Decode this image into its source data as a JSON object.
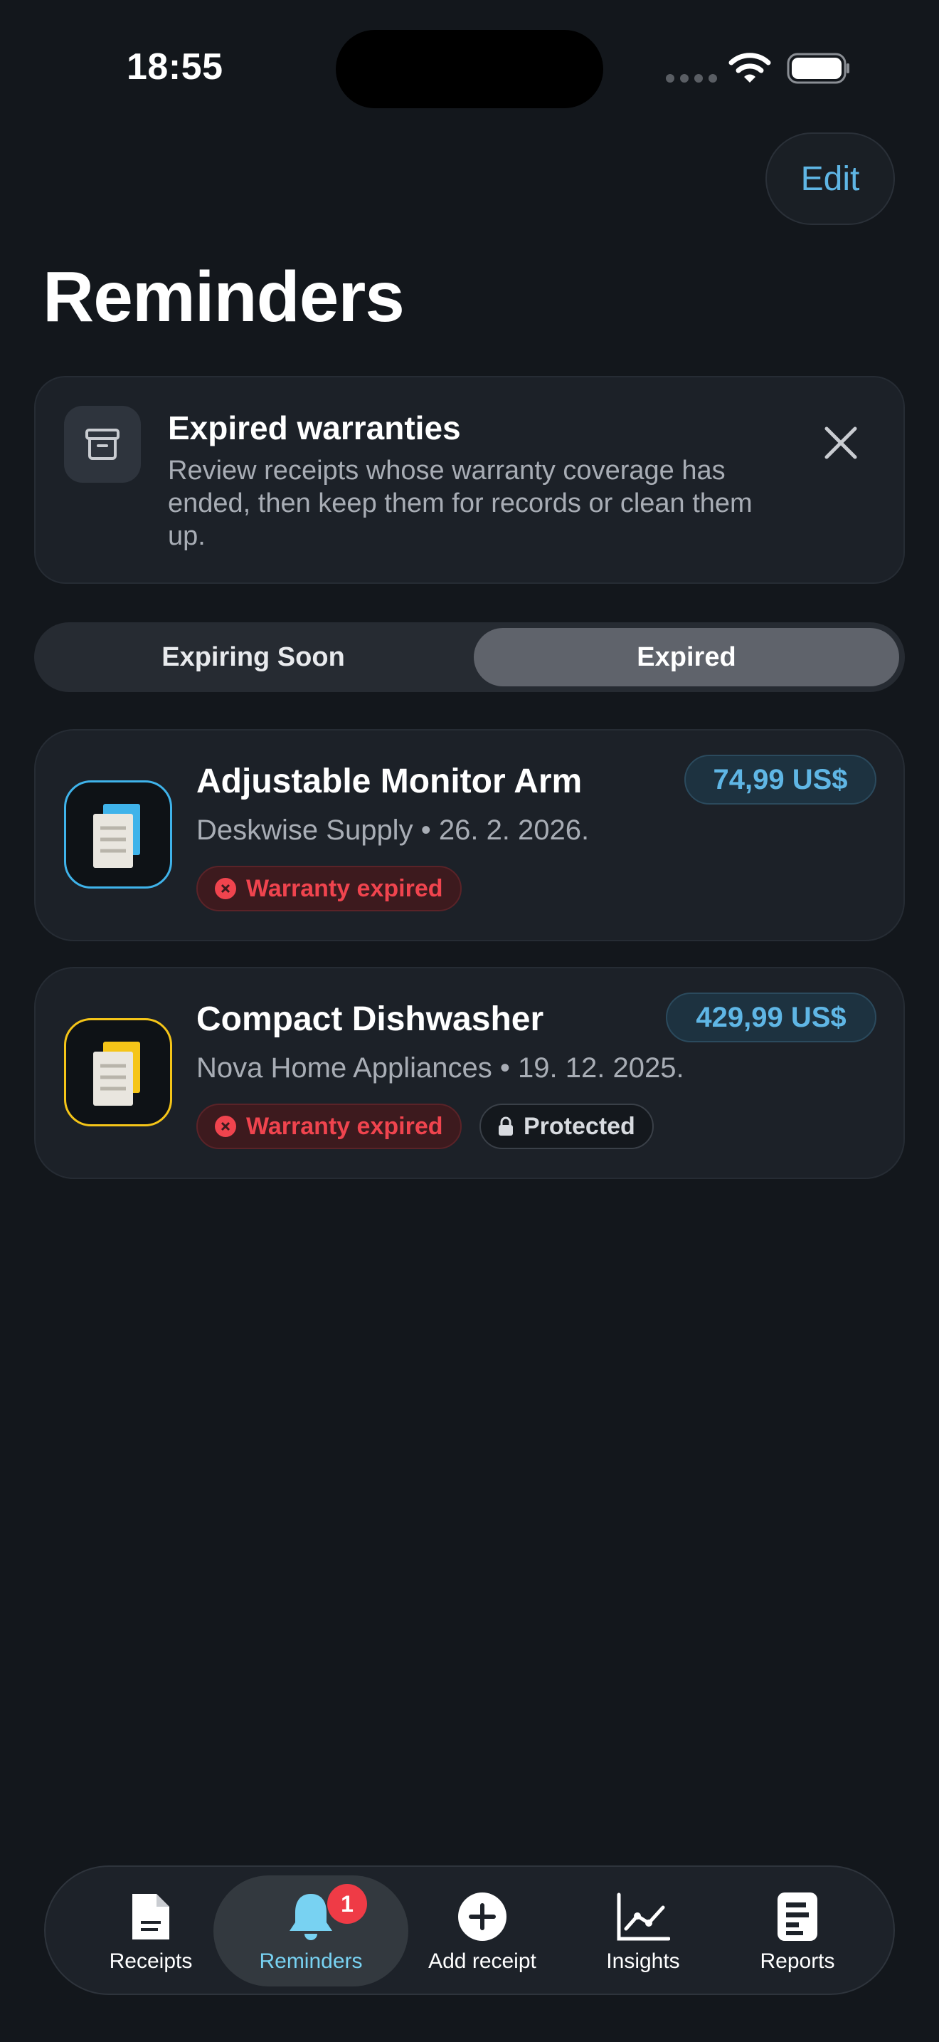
{
  "status_bar": {
    "time": "18:55"
  },
  "header": {
    "edit_label": "Edit",
    "title": "Reminders"
  },
  "banner": {
    "icon": "archive-icon",
    "title": "Expired warranties",
    "text": "Review receipts whose warranty coverage has ended, then keep them for records or clean them up."
  },
  "segments": {
    "left": "Expiring Soon",
    "right": "Expired",
    "selected": "Expired"
  },
  "receipts": [
    {
      "title": "Adjustable Monitor Arm",
      "merchant": "Deskwise Supply",
      "date": "26. 2. 2026.",
      "price": "74,99 US$",
      "status": "Warranty expired",
      "accent": "#3fb3ea"
    },
    {
      "title": "Compact Dishwasher",
      "merchant": "Nova Home Appliances",
      "date": "19. 12. 2025.",
      "price": "429,99 US$",
      "status": "Warranty expired",
      "protected": "Protected",
      "accent": "#f5c518"
    }
  ],
  "separator": "•",
  "tabbar": {
    "receipts": "Receipts",
    "reminders": "Reminders",
    "reminders_badge": "1",
    "add": "Add receipt",
    "insights": "Insights",
    "reports": "Reports"
  },
  "colors": {
    "accent": "#5fb6e5",
    "active_tab": "#78d2f2",
    "danger": "#f0444e",
    "background": "#13171c"
  }
}
